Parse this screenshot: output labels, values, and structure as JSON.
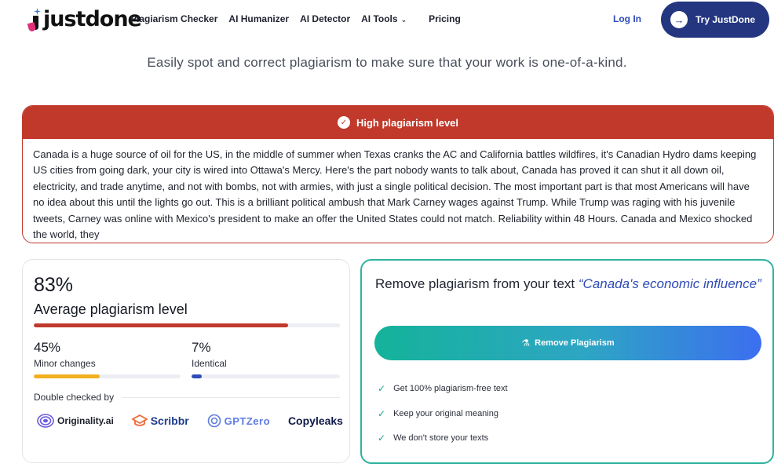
{
  "nav": {
    "logo_text": "justdone",
    "links": [
      "Plagiarism Checker",
      "AI Humanizer",
      "AI Detector",
      "AI Tools",
      "Pricing"
    ],
    "login": "Log In",
    "cta": "Try JustDone"
  },
  "subtitle": "Easily spot and correct plagiarism to make sure that your work is one-of-a-kind.",
  "result": {
    "status": "High plagiarism level",
    "text": "Canada is a huge source of oil for the US, in the middle of summer when Texas cranks the AC and California battles wildfires, it's Canadian Hydro dams keeping US cities from going dark, your city is wired into Ottawa's Mercy. Here's the part nobody wants to talk about, Canada has proved it can shut it all down oil, electricity, and trade anytime, and not with bombs, not with armies, with just a single political decision. The most important part is that most Americans will have no idea about this until the lights go out. This is a brilliant political ambush that Mark Carney wages against Trump. While Trump was raging with his juvenile tweets, Carney was online with Mexico's president to make an offer the United States could not match. Reliability within 48 Hours. Canada and Mexico shocked the world, they"
  },
  "stats": {
    "average_pct": "83%",
    "average_value": 0.83,
    "average_label": "Average plagiarism level",
    "minor_pct": "45%",
    "minor_value": 0.45,
    "minor_label": "Minor changes",
    "identical_pct": "7%",
    "identical_value": 0.07,
    "identical_label": "Identical",
    "double_checked": "Double checked by",
    "checkers": [
      "Originality.ai",
      "Scribbr",
      "GPTZero",
      "Copyleaks"
    ]
  },
  "remove": {
    "title": "Remove plagiarism from your text",
    "quote": "“Canada's economic influence”",
    "button": "Remove Plagiarism",
    "features": [
      "Get 100% plagiarism-free text",
      "Keep your original meaning",
      "We don't store your texts"
    ]
  },
  "colors": {
    "danger": "#c0392b",
    "brand_dark": "#23367f",
    "accent_blue": "#2e4bb7",
    "minor_bar": "#f2b01e",
    "identical_bar": "#2e4bb7",
    "teal": "#2fb39e"
  }
}
